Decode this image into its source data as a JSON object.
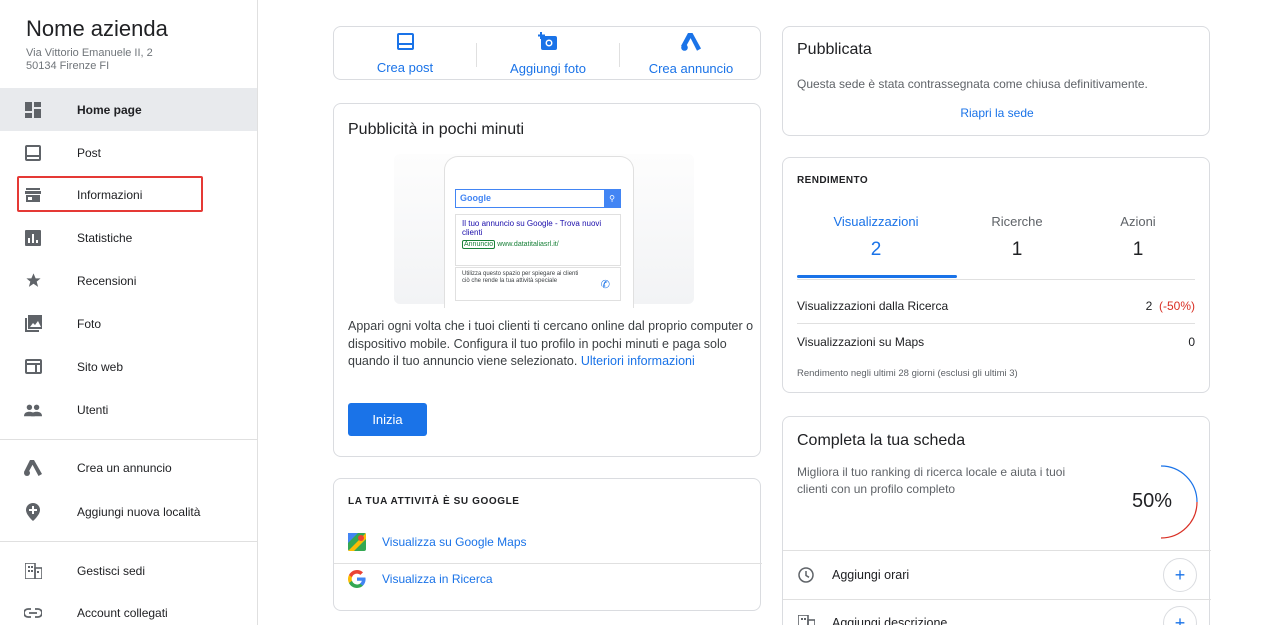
{
  "business": {
    "name": "Nome azienda",
    "address_line1": "Via Vittorio Emanuele II, 2",
    "address_line2": "50134 Firenze FI"
  },
  "sidebar": {
    "items": [
      {
        "label": "Home page",
        "icon": "dashboard-icon"
      },
      {
        "label": "Post",
        "icon": "post-icon"
      },
      {
        "label": "Informazioni",
        "icon": "storefront-icon"
      },
      {
        "label": "Statistiche",
        "icon": "bar-chart-icon"
      },
      {
        "label": "Recensioni",
        "icon": "star-icon"
      },
      {
        "label": "Foto",
        "icon": "photo-icon"
      },
      {
        "label": "Sito web",
        "icon": "web-icon"
      },
      {
        "label": "Utenti",
        "icon": "people-icon"
      },
      {
        "label": "Crea un annuncio",
        "icon": "google-ads-icon"
      },
      {
        "label": "Aggiungi nuova località",
        "icon": "add-location-icon"
      },
      {
        "label": "Gestisci sedi",
        "icon": "buildings-icon"
      },
      {
        "label": "Account collegati",
        "icon": "link-icon"
      }
    ]
  },
  "quick_actions": {
    "create_post": "Crea post",
    "add_photo": "Aggiungi foto",
    "create_ad": "Crea annuncio"
  },
  "ads_card": {
    "title": "Pubblicità in pochi minuti",
    "description": "Appari ogni volta che i tuoi clienti ti cercano online dal proprio computer o dispositivo mobile. Configura il tuo profilo in pochi minuti e paga solo quando il tuo annuncio viene selezionato.",
    "more_link": "Ulteriori informazioni",
    "button": "Inizia",
    "mock": {
      "google_logo": "Google",
      "ad_title": "Il tuo annuncio su Google - Trova nuovi clienti",
      "ad_badge": "Annuncio",
      "ad_url": "www.datatitaliasrl.it/",
      "ad_text": "Utilizza questo spazio per spiegare ai clienti ciò che rende la tua attività speciale"
    }
  },
  "google_card": {
    "title": "LA TUA ATTIVITÀ È SU GOOGLE",
    "maps_link": "Visualizza su Google Maps",
    "search_link": "Visualizza in Ricerca"
  },
  "published_card": {
    "title": "Pubblicata",
    "description": "Questa sede è stata contrassegnata come chiusa definitivamente.",
    "reopen_link": "Riapri la sede"
  },
  "performance": {
    "title": "RENDIMENTO",
    "tabs": [
      {
        "label": "Visualizzazioni",
        "value": "2"
      },
      {
        "label": "Ricerche",
        "value": "1"
      },
      {
        "label": "Azioni",
        "value": "1"
      }
    ],
    "rows": [
      {
        "label": "Visualizzazioni dalla Ricerca",
        "value": "2",
        "change": "(-50%)"
      },
      {
        "label": "Visualizzazioni su Maps",
        "value": "0"
      }
    ],
    "note": "Rendimento negli ultimi 28 giorni (esclusi gli ultimi 3)"
  },
  "complete_card": {
    "title": "Completa la tua scheda",
    "description": "Migliora il tuo ranking di ricerca locale e aiuta i tuoi clienti con un profilo completo",
    "percent_label": "50%",
    "progress_fraction": 0.5,
    "items": [
      {
        "label": "Aggiungi orari",
        "icon": "clock-icon"
      },
      {
        "label": "Aggiungi descrizione",
        "icon": "building-icon"
      }
    ]
  },
  "colors": {
    "accent": "#1a73e8",
    "highlight_box": "#e53935",
    "negative": "#d93025"
  }
}
